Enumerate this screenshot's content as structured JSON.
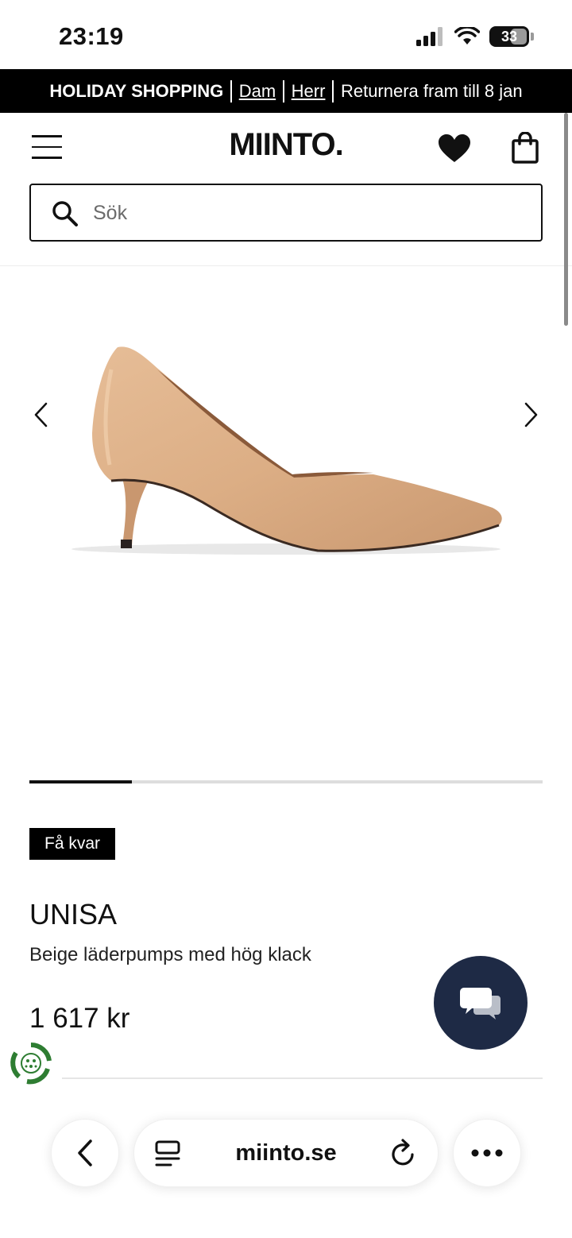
{
  "status_bar": {
    "time": "23:19",
    "battery": "33"
  },
  "promo": {
    "title": "HOLIDAY SHOPPING",
    "link_women": "Dam",
    "link_men": "Herr",
    "returns": "Returnera fram till 8 jan"
  },
  "header": {
    "logo": "MIINTO."
  },
  "search": {
    "placeholder": "Sök",
    "value": ""
  },
  "gallery": {
    "current_image": 1,
    "total_images": 5,
    "progress_fraction": 0.2
  },
  "product": {
    "badge": "Få kvar",
    "brand": "UNISA",
    "description": "Beige läderpumps med hög klack",
    "price": "1 617 kr"
  },
  "browser": {
    "url": "miinto.se"
  },
  "colors": {
    "accent_dark": "#1e2a45",
    "eco_green": "#2e7d32",
    "shoe": "#dcae85"
  },
  "icons": [
    "menu-icon",
    "heart-icon",
    "bag-icon",
    "search-icon",
    "chevron-left-icon",
    "chevron-right-icon",
    "chat-icon",
    "eco-icon",
    "back-icon",
    "reader-icon",
    "reload-icon",
    "more-icon"
  ]
}
